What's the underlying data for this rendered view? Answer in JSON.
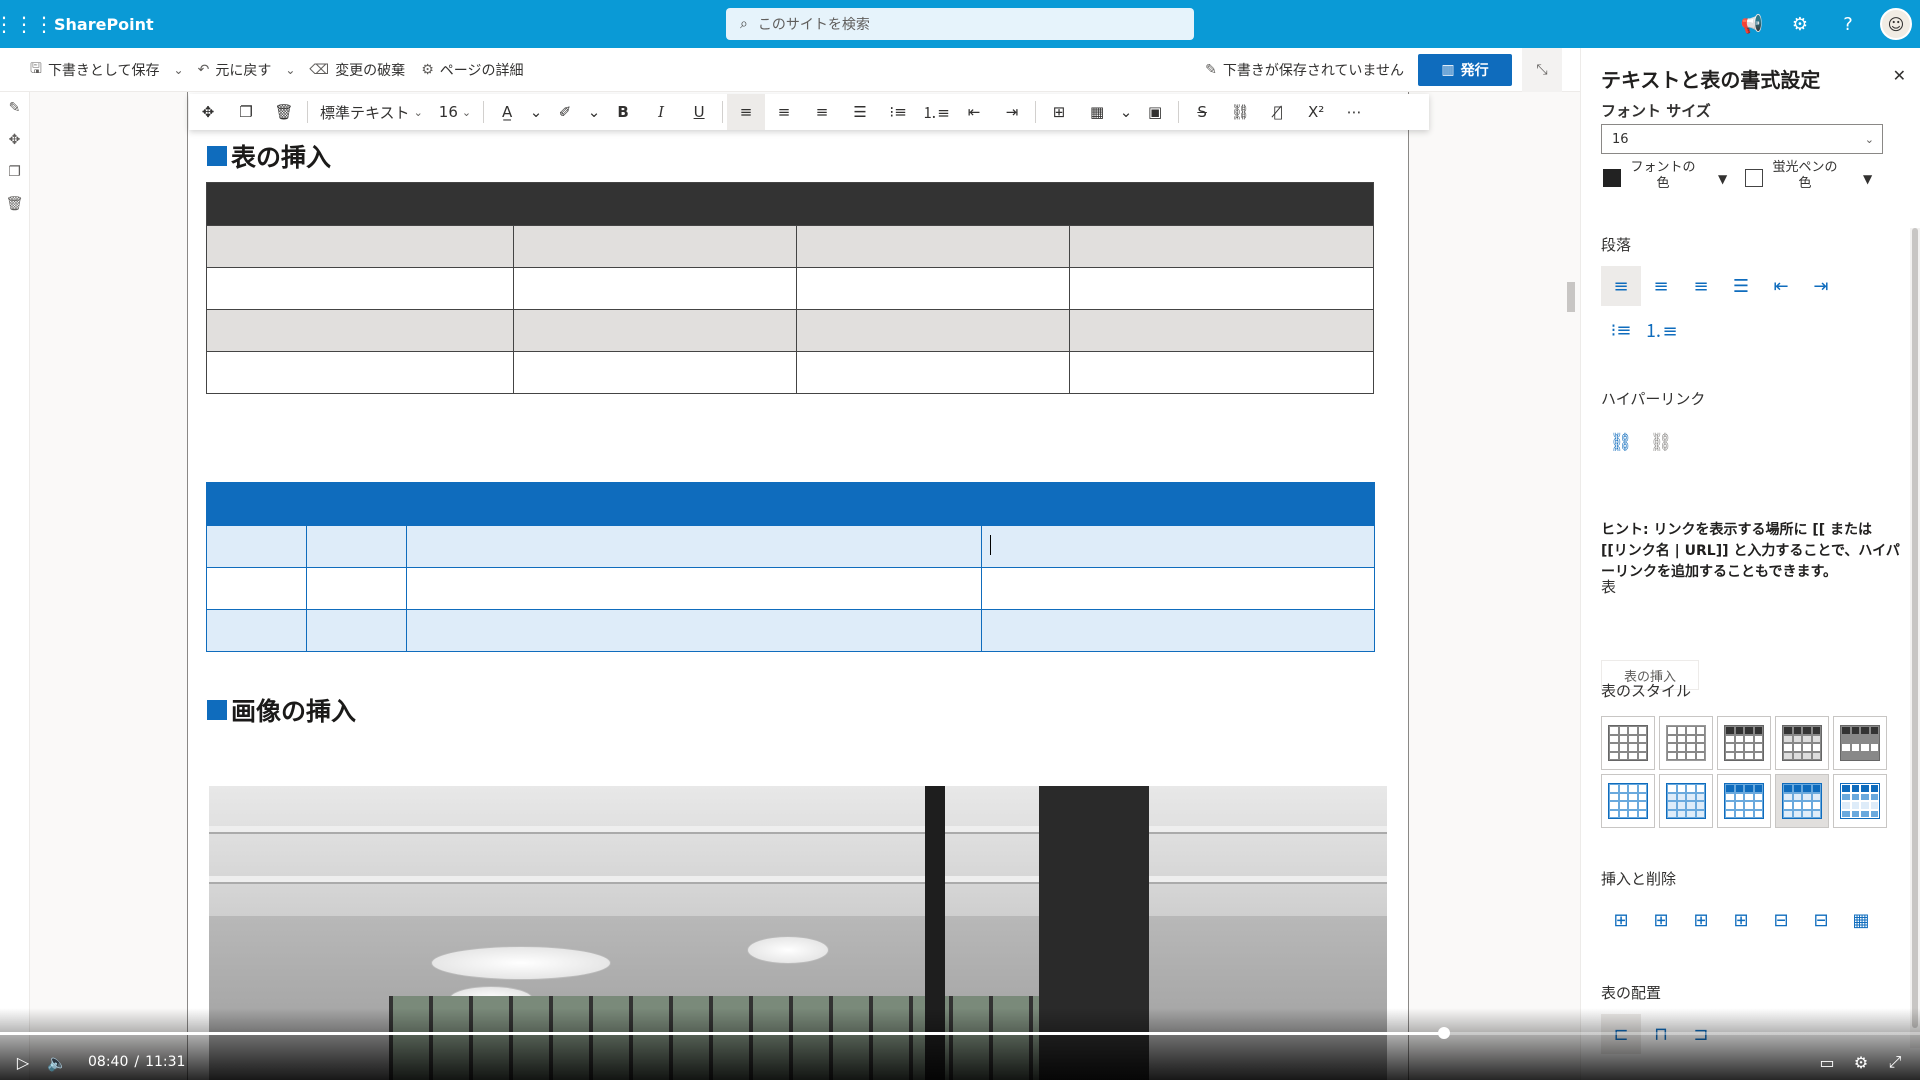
{
  "suite": {
    "brand": "SharePoint",
    "search_placeholder": "このサイトを検索"
  },
  "commandbar": {
    "save_draft": "下書きとして保存",
    "undo": "元に戻す",
    "discard": "変更の破棄",
    "page_details": "ページの詳細",
    "unsaved": "下書きが保存されていません",
    "publish": "発行"
  },
  "toolbar": {
    "style": "標準テキスト",
    "font_size": "16"
  },
  "content": {
    "heading_table": "表の挿入",
    "heading_image": "画像の挿入"
  },
  "pane": {
    "title": "テキストと表の書式設定",
    "font_size_label": "フォント サイズ",
    "font_size_value": "16",
    "font_color": "フォントの色",
    "highlight_color": "蛍光ペンの色",
    "paragraph": "段落",
    "hyperlink": "ハイパーリンク",
    "hint": "ヒント: リンクを表示する場所に [[ または [[リンク名 | URL]] と入力することで、ハイパーリンクを追加することもできます。",
    "table": "表",
    "insert_table": "表の挿入",
    "table_style": "表のスタイル",
    "insert_delete": "挿入と削除",
    "table_alignment": "表の配置"
  },
  "player": {
    "current": "08:40",
    "separator": "/",
    "total": "11:31",
    "progress_fraction": 0.752
  },
  "colors": {
    "suite": "#0a9ad6",
    "accent": "#0f6cbd",
    "table_dark_header": "#333333",
    "table_alt_row": "#e1dfdd",
    "table_blue_alt": "#deecf9"
  }
}
